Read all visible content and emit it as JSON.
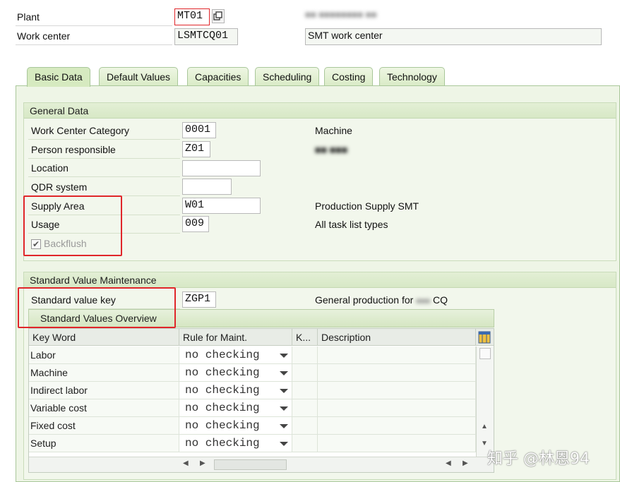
{
  "header": {
    "plant_label": "Plant",
    "plant_value": "MT01",
    "plant_desc": "■■ ■■■■■■■■ ■■",
    "work_center_label": "Work center",
    "work_center_value": "LSMTCQ01",
    "work_center_desc": "SMT work center"
  },
  "tabs": [
    {
      "label": "Basic Data",
      "active": true
    },
    {
      "label": "Default Values"
    },
    {
      "label": "Capacities"
    },
    {
      "label": "Scheduling"
    },
    {
      "label": "Costing"
    },
    {
      "label": "Technology"
    }
  ],
  "general_data": {
    "title": "General Data",
    "rows": [
      {
        "label": "Work Center Category",
        "value": "0001",
        "desc": "Machine"
      },
      {
        "label": "Person responsible",
        "value": "Z01",
        "desc": "■■ ■■■"
      },
      {
        "label": "Location",
        "value": "",
        "desc": ""
      },
      {
        "label": "QDR system",
        "value": "",
        "desc": ""
      },
      {
        "label": "Supply Area",
        "value": "W01",
        "desc": "Production Supply SMT"
      },
      {
        "label": "Usage",
        "value": "009",
        "desc": "All task list types"
      }
    ],
    "backflush_label": "Backflush",
    "backflush_checked": true
  },
  "standard_values": {
    "title": "Standard Value Maintenance",
    "key_label": "Standard value key",
    "key_value": "ZGP1",
    "key_desc_prefix": "General production for",
    "key_desc_suffix": "CQ",
    "overview_button": "Standard Values Overview",
    "columns": [
      "Key Word",
      "Rule for Maint.",
      "K...",
      "Description"
    ],
    "rows": [
      {
        "keyword": "Labor",
        "rule": "no checking"
      },
      {
        "keyword": "Machine",
        "rule": "no checking"
      },
      {
        "keyword": "Indirect labor",
        "rule": "no checking"
      },
      {
        "keyword": "Variable cost",
        "rule": "no checking"
      },
      {
        "keyword": "Fixed cost",
        "rule": "no checking"
      },
      {
        "keyword": "Setup",
        "rule": "no checking"
      }
    ]
  },
  "watermark": "知乎 @林恩94",
  "colors": {
    "highlight_red": "#e0262a",
    "tab_green": "#d6eac0",
    "panel_green": "#eef5e6"
  }
}
